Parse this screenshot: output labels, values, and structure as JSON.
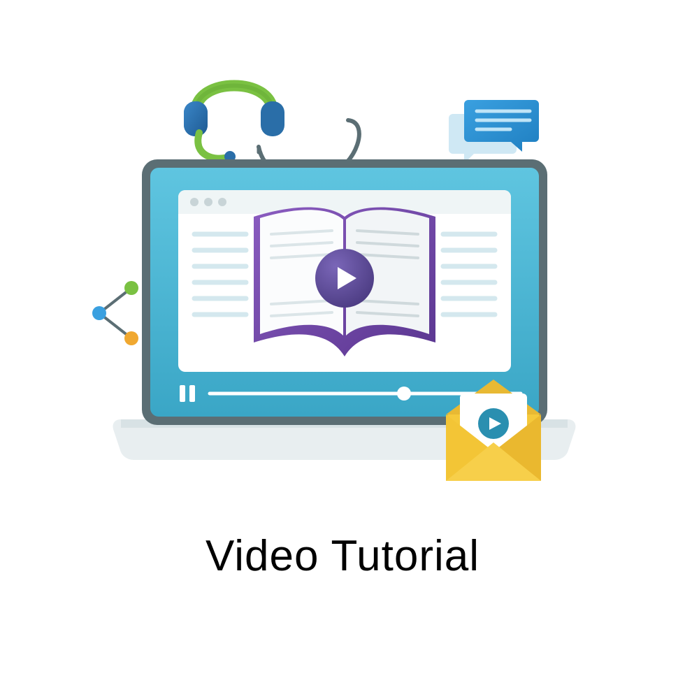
{
  "caption": "Video Tutorial",
  "icons": {
    "laptop": "laptop-icon",
    "browser_window": "browser-window-icon",
    "book": "open-book-icon",
    "play_main": "play-icon",
    "pause": "pause-icon",
    "progress": "progress-bar-icon",
    "headphones": "headphones-icon",
    "chat": "chat-bubbles-icon",
    "share": "share-icon",
    "envelope": "video-mail-icon",
    "play_small": "play-icon"
  },
  "colors": {
    "screen": "#49b7d6",
    "screen_dark": "#2a8fb0",
    "frame": "#5b6e74",
    "base": "#e8eef0",
    "window": "#ffffff",
    "book_purple": "#6b3fa0",
    "book_purple_light": "#8a5cc0",
    "play_purple": "#5e4a9e",
    "play_purple_dark": "#4a3a80",
    "headphone_green": "#7ac142",
    "headphone_blue": "#2a6ea8",
    "chat_blue": "#1f7fc1",
    "chat_blue_light": "#3aa0e0",
    "envelope_yellow": "#f5c93b",
    "envelope_yellow_dark": "#e0a928",
    "share_green": "#7ac142",
    "share_blue": "#3aa0e0",
    "share_orange": "#f0a830",
    "line_gray": "#d4e8ee"
  }
}
